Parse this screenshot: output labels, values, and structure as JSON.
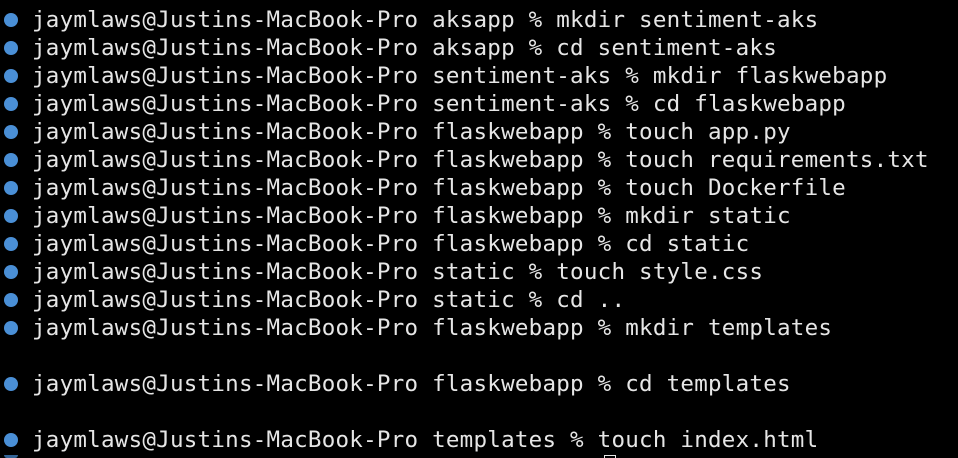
{
  "terminal": {
    "colors": {
      "background": "#000000",
      "text": "#e6e6e6",
      "status_dot": "#4a8fd6"
    },
    "lines": [
      {
        "prompt": "jaymlaws@Justins-MacBook-Pro aksapp % mkdir sentiment-aks"
      },
      {
        "prompt": "jaymlaws@Justins-MacBook-Pro aksapp % cd sentiment-aks"
      },
      {
        "prompt": "jaymlaws@Justins-MacBook-Pro sentiment-aks % mkdir flaskwebapp"
      },
      {
        "prompt": "jaymlaws@Justins-MacBook-Pro sentiment-aks % cd flaskwebapp"
      },
      {
        "prompt": "jaymlaws@Justins-MacBook-Pro flaskwebapp % touch app.py"
      },
      {
        "prompt": "jaymlaws@Justins-MacBook-Pro flaskwebapp % touch requirements.txt"
      },
      {
        "prompt": "jaymlaws@Justins-MacBook-Pro flaskwebapp % touch Dockerfile"
      },
      {
        "prompt": "jaymlaws@Justins-MacBook-Pro flaskwebapp % mkdir static"
      },
      {
        "prompt": "jaymlaws@Justins-MacBook-Pro flaskwebapp % cd static"
      },
      {
        "prompt": "jaymlaws@Justins-MacBook-Pro static % touch style.css"
      },
      {
        "prompt": "jaymlaws@Justins-MacBook-Pro static % cd .."
      },
      {
        "prompt": "jaymlaws@Justins-MacBook-Pro flaskwebapp % mkdir templates"
      },
      {
        "prompt": "jaymlaws@Justins-MacBook-Pro flaskwebapp % cd templates"
      },
      {
        "prompt": "jaymlaws@Justins-MacBook-Pro templates % touch index.html"
      }
    ]
  }
}
